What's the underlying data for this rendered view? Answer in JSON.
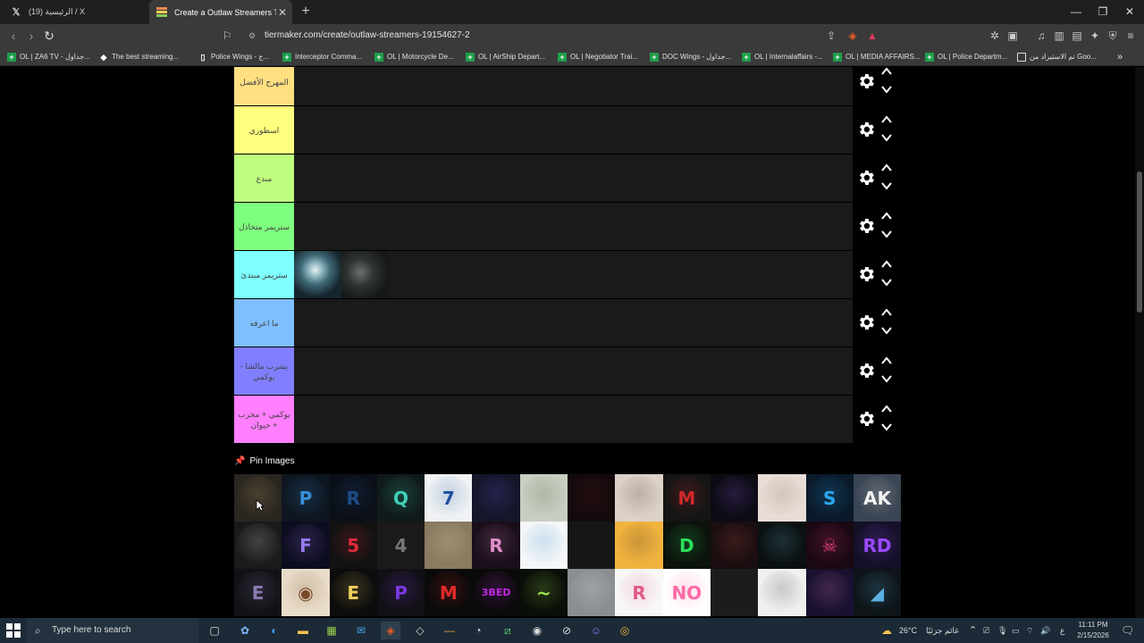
{
  "tabs": [
    {
      "title": "(19) الرئيسية / X",
      "icon": "x-logo-icon"
    },
    {
      "title": "Create a Outlaw Streamers Tier L",
      "icon": "tiermaker-icon"
    }
  ],
  "address_bar": {
    "url": "tiermaker.com/create/outlaw-streamers-19154627-2"
  },
  "bookmarks": [
    {
      "label": "OL | ZA6 TV - جداول...",
      "icon": "sheets-icon"
    },
    {
      "label": "The best streaming...",
      "icon": "diamond-icon"
    },
    {
      "label": "Police Wings - ج...",
      "icon": "document-icon"
    },
    {
      "label": "Interceptor Comma...",
      "icon": "sheets-icon"
    },
    {
      "label": "OL | Motorcycle De...",
      "icon": "sheets-icon"
    },
    {
      "label": "OL | AirShip Depart...",
      "icon": "sheets-icon"
    },
    {
      "label": "OL | Negotiator Trai...",
      "icon": "sheets-icon"
    },
    {
      "label": "DOC Wings - جداول...",
      "icon": "sheets-icon"
    },
    {
      "label": "OL | Internalaffairs -...",
      "icon": "sheets-icon"
    },
    {
      "label": "OL | MEDIA AFFAIRS...",
      "icon": "sheets-icon"
    },
    {
      "label": "OL | Police Departm...",
      "icon": "sheets-icon"
    },
    {
      "label": "تم الاستيراد من Goo...",
      "icon": "folder-icon"
    }
  ],
  "tiers": [
    {
      "label": "المهرج الأفضل",
      "color": "#ffdf80"
    },
    {
      "label": "اسطوري",
      "color": "#ffff7f"
    },
    {
      "label": "مبدع",
      "color": "#bfff7f"
    },
    {
      "label": "ستريمر متخاذل",
      "color": "#7fff7f"
    },
    {
      "label": "ستريمر مبتدئ",
      "color": "#7fffff"
    },
    {
      "label": "ما اعرفه",
      "color": "#7fbfff"
    },
    {
      "label": "يشرب مالشا - بوكمي",
      "color": "#807fff"
    },
    {
      "label": "بوكمي + مخرب + حيوان",
      "color": "#ff7fff"
    }
  ],
  "pin_images": {
    "label": "Pin Images"
  },
  "taskbar": {
    "search_placeholder": "Type here to search",
    "weather": "26°C",
    "weather_text": "غائم جزئيًا",
    "lang": "ع",
    "time": "11:11 PM",
    "date": "2/15/2026"
  }
}
